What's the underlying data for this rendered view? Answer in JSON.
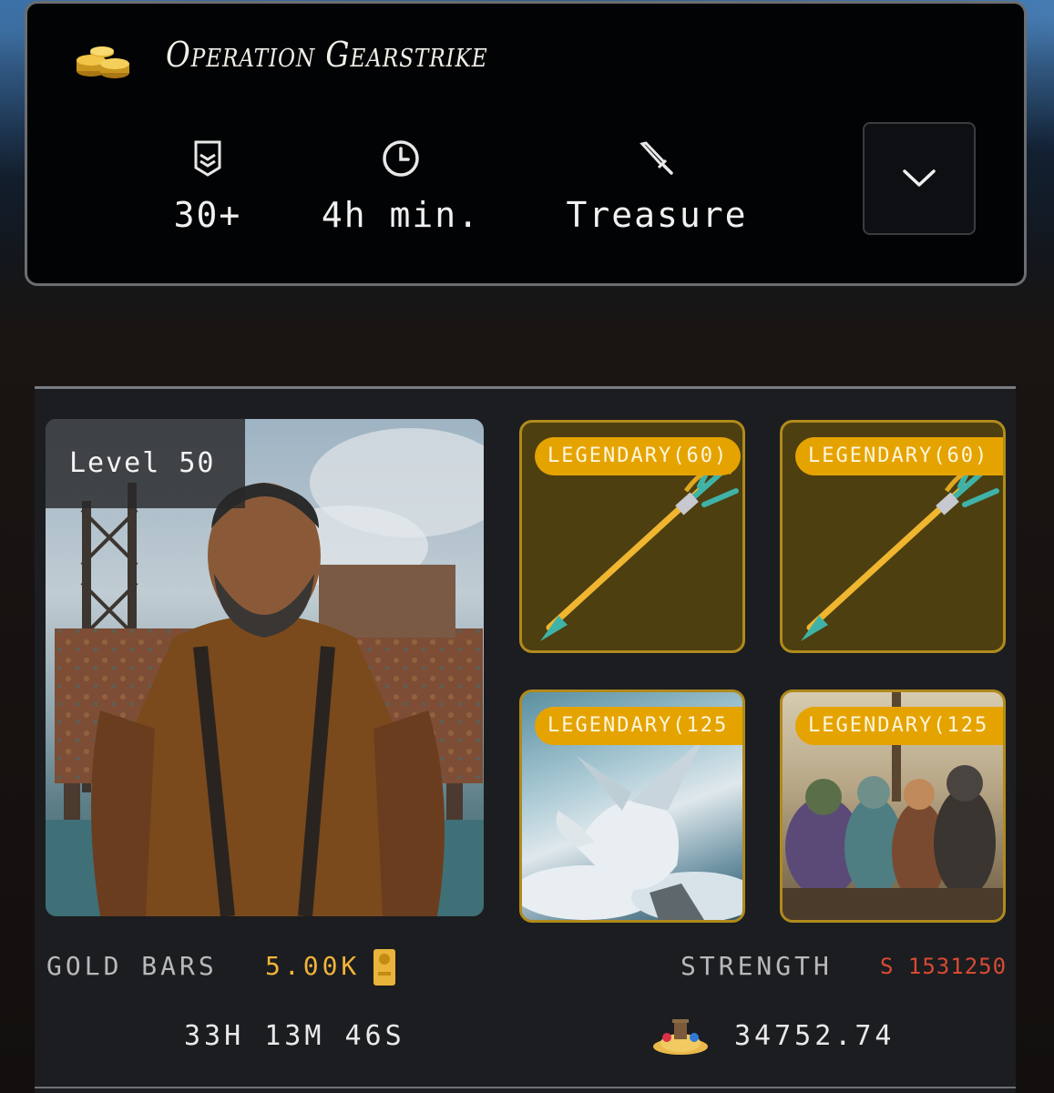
{
  "mission": {
    "title": "Operation Gearstrike",
    "stats": {
      "level": "30+",
      "duration": "4h min.",
      "type": "Treasure"
    },
    "icons": {
      "coins": "gold-coins-icon",
      "level": "rank-chevron-icon",
      "duration": "clock-icon",
      "type": "sword-icon",
      "expand": "chevron-down-icon"
    }
  },
  "hero": {
    "level_label": "Level 50",
    "gold_label": "GOLD BARS",
    "gold_value": "5.00K",
    "strength_label": "STRENGTH",
    "strength_value": "S 1531250",
    "timer": "33H 13M 46S",
    "treasure_value": "34752.74"
  },
  "items": [
    {
      "tag": "LEGENDARY(60)",
      "kind": "trident"
    },
    {
      "tag": "LEGENDARY(60)",
      "kind": "trident"
    },
    {
      "tag": "LEGENDARY(125",
      "kind": "dragon-art"
    },
    {
      "tag": "LEGENDARY(125",
      "kind": "pirate-crew-art"
    }
  ],
  "colors": {
    "accent_gold": "#e5a300",
    "gold_value": "#f0b33a",
    "strength_value": "#d84a34",
    "card_border": "#b08a1c"
  }
}
